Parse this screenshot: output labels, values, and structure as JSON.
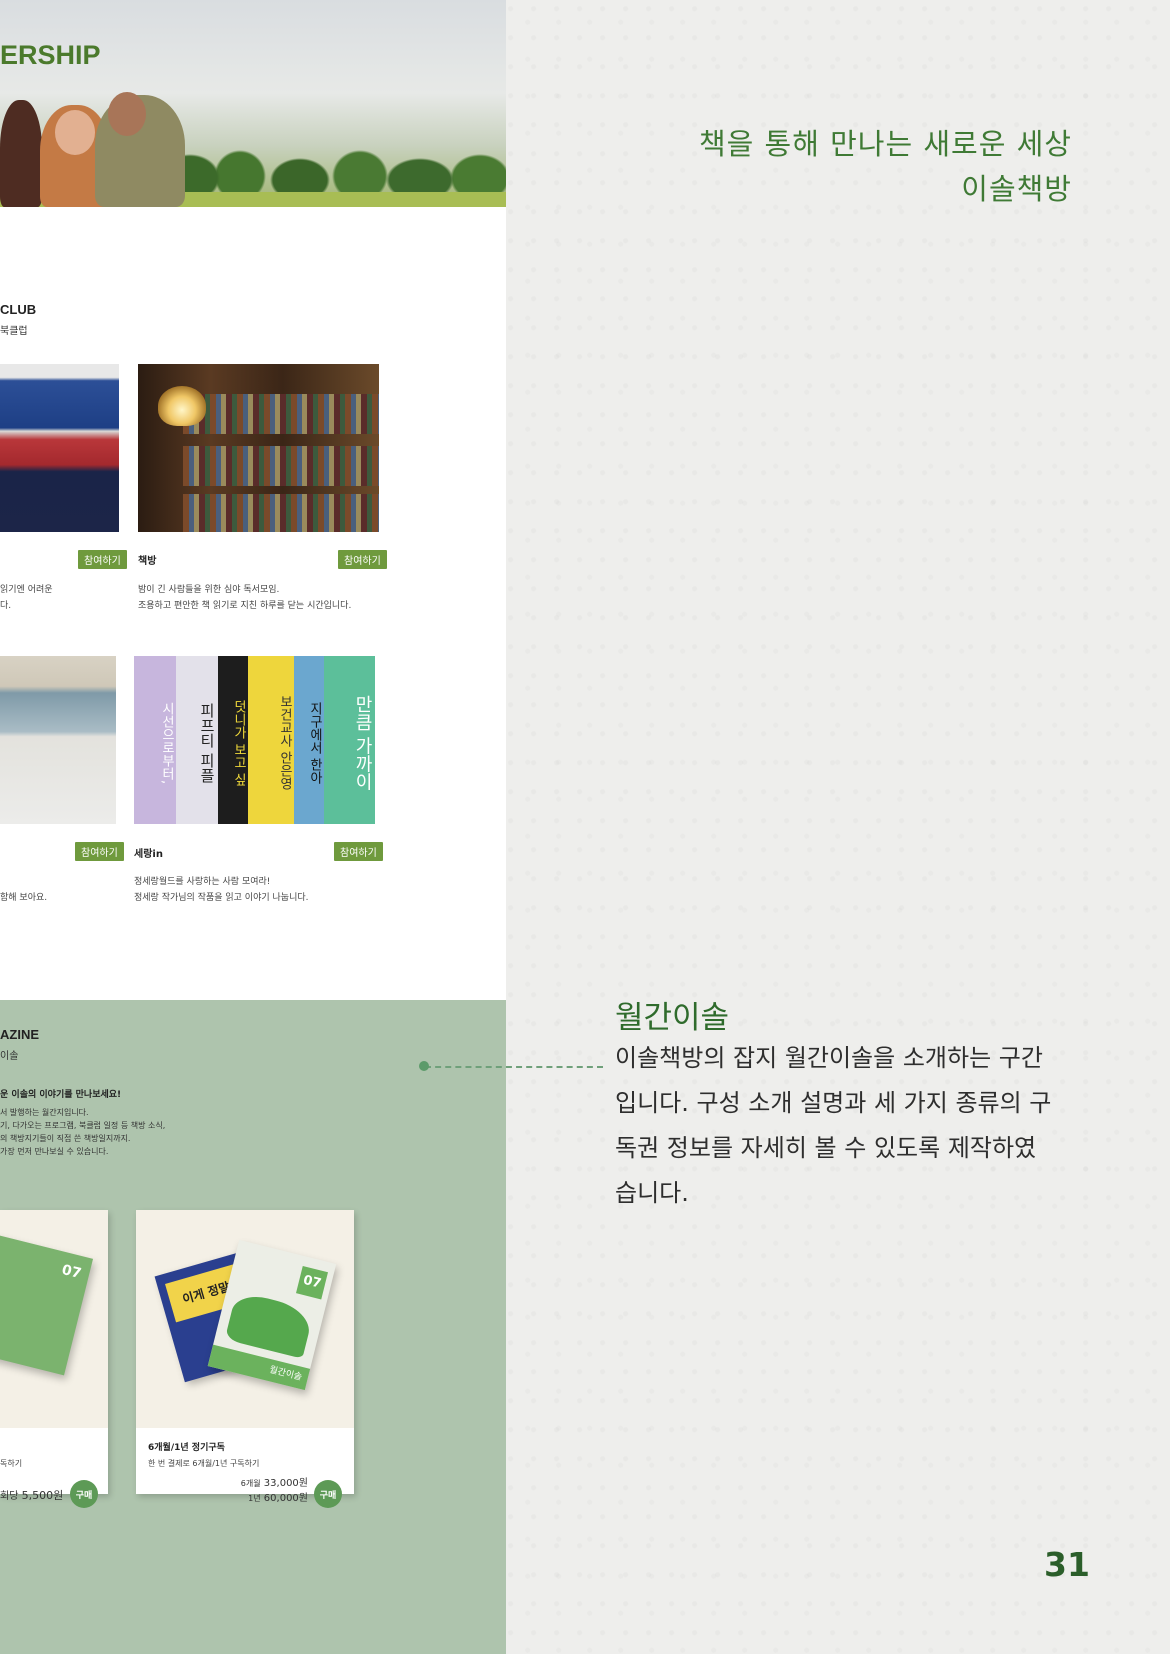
{
  "tagline": {
    "line1": "책을 통해 만나는 새로운 세상",
    "line2": "이솔책방"
  },
  "section": {
    "title": "월간이솔",
    "description": "이솔책방의 잡지 월간이솔을 소개하는 구간입니다. 구성 소개 설명과 세 가지 종류의 구독권 정보를 자세히 볼 수 있도록 제작하였습니다."
  },
  "page_number": "31",
  "site": {
    "hero_title": "ERSHIP",
    "club": {
      "title": "CLUB",
      "subtitle": "북클럽",
      "cards": [
        {
          "badge": "참여하기",
          "name": "",
          "desc1": "읽기엔 어려운",
          "desc2": "다."
        },
        {
          "badge": "참여하기",
          "name": "책방",
          "desc1": "밤이 긴 사람들을 위한 심야 독서모임.",
          "desc2": "조용하고 편안한 책 읽기로 지친 하루를 닫는 시간입니다."
        },
        {
          "badge": "참여하기",
          "name": "",
          "desc1": "",
          "desc2": "함해 보아요."
        },
        {
          "badge": "참여하기",
          "name": "세랑in",
          "desc1": "정세랑월드를 사랑하는 사람 모여라!",
          "desc2": "정세랑 작가님의 작품을 읽고 이야기 나눕니다."
        }
      ],
      "spines": [
        "시선으로부터,",
        "피프티 피플",
        "덧니가 보고 싶",
        "보건교사 안은영",
        "지구에서 한아",
        "만큼 가까이"
      ]
    },
    "magazine": {
      "title": "AZINE",
      "subtitle": "이솔",
      "headline": "운 이솔의 이야기를 만나보세요!",
      "body": [
        "서 발행하는 월간지입니다.",
        "기, 다가오는 프로그램, 북클럽 일정 등 책방 소식,",
        "의 책방지기들이 직접 쓴 책방일지까지.",
        "가장 먼저 만나보실 수 있습니다."
      ],
      "cover_labels": [
        "07",
        "월간이솔",
        "이게 정말"
      ],
      "products": [
        {
          "name": "",
          "desc": "독하기",
          "price_label": "회당",
          "price": "5,500원",
          "buy": "구매"
        },
        {
          "name": "6개월/1년 정기구독",
          "desc": "한 번 결제로 6개월/1년 구독하기",
          "price_rows": [
            {
              "label": "6개월",
              "price": "33,000원"
            },
            {
              "label": "1년",
              "price": "60,000원"
            }
          ],
          "buy": "구매"
        }
      ]
    }
  }
}
